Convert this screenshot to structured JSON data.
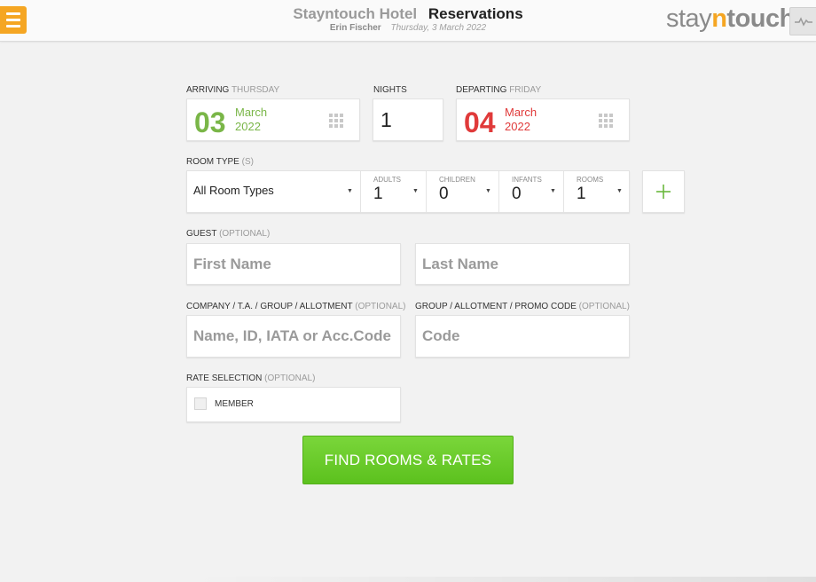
{
  "header": {
    "hotel_name": "Stayntouch Hotel",
    "page_title": "Reservations",
    "user_name": "Erin Fischer",
    "date": "Thursday, 3 March 2022",
    "logo": {
      "pre": "stay",
      "n": "n",
      "post": "touch"
    },
    "menu_icon": "hamburger-icon",
    "pulse_icon": "pulse-icon",
    "accent_color": "#f5a623"
  },
  "arriving": {
    "label": "Arriving",
    "weekday": "Thursday",
    "day": "03",
    "month": "March",
    "year": "2022",
    "color": "#7ab648",
    "icon": "calendar-grid-icon"
  },
  "nights": {
    "label": "Nights",
    "value": "1"
  },
  "departing": {
    "label": "Departing",
    "weekday": "Friday",
    "day": "04",
    "month": "March",
    "year": "2022",
    "color": "#e03a3a",
    "icon": "calendar-grid-icon"
  },
  "room_type": {
    "label": "Room Type",
    "suffix": "(s)",
    "value": "All Room Types",
    "adults": {
      "label": "Adults",
      "value": "1"
    },
    "children": {
      "label": "Children",
      "value": "0"
    },
    "infants": {
      "label": "Infants",
      "value": "0"
    },
    "rooms": {
      "label": "Rooms",
      "value": "1"
    },
    "add_icon": "plus-icon"
  },
  "guest": {
    "label": "Guest",
    "optional": "(optional)",
    "first_name_placeholder": "First Name",
    "last_name_placeholder": "Last Name"
  },
  "company": {
    "label": "Company / T.A. / Group / Allotment",
    "optional": "(optional)",
    "placeholder": "Name, ID, IATA or Acc.Code"
  },
  "promo": {
    "label": "Group / Allotment / Promo Code",
    "optional": "(optional)",
    "placeholder": "Code"
  },
  "rate_selection": {
    "label": "Rate Selection",
    "optional": "(optional)",
    "member_label": "Member",
    "member_checked": false
  },
  "find_button": {
    "label": "FIND ROOMS & RATES",
    "color": "#5cc11e"
  }
}
